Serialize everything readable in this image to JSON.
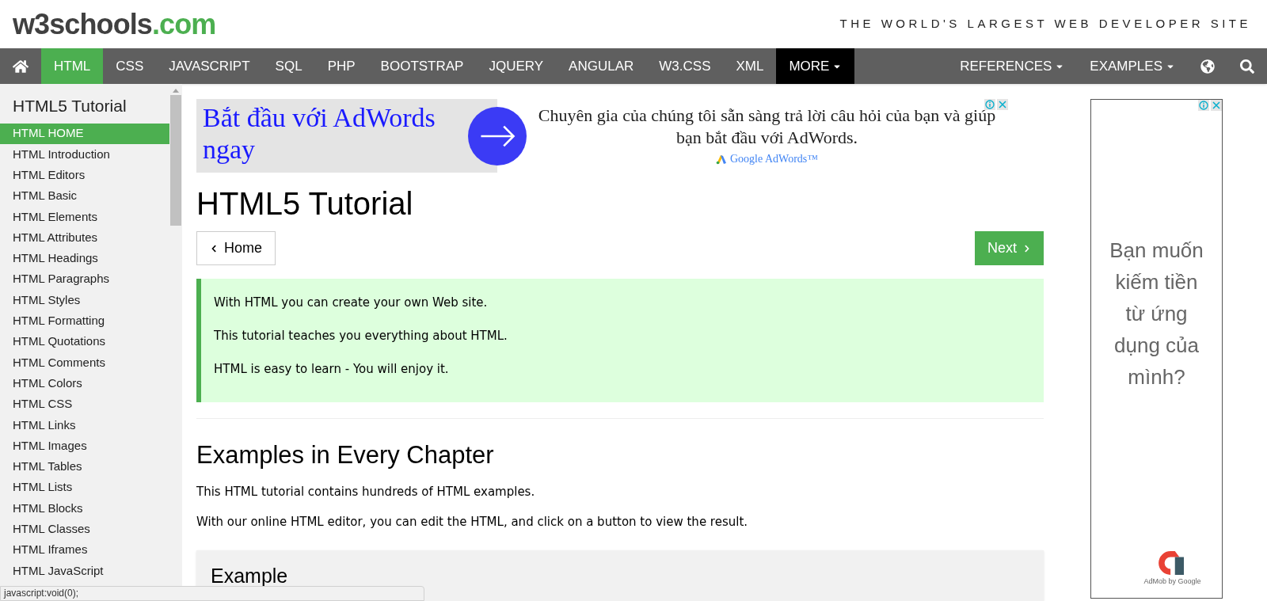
{
  "logo": {
    "name": "w3schools",
    "suffix": ".com"
  },
  "tagline": "THE WORLD'S LARGEST WEB DEVELOPER SITE",
  "nav_items": [
    {
      "label": "HTML",
      "kind": "link",
      "selected": true
    },
    {
      "label": "CSS",
      "kind": "link",
      "selected": false
    },
    {
      "label": "JAVASCRIPT",
      "kind": "link",
      "selected": false
    },
    {
      "label": "SQL",
      "kind": "link",
      "selected": false
    },
    {
      "label": "PHP",
      "kind": "link",
      "selected": false
    },
    {
      "label": "BOOTSTRAP",
      "kind": "link",
      "selected": false
    },
    {
      "label": "JQUERY",
      "kind": "link",
      "selected": false
    },
    {
      "label": "ANGULAR",
      "kind": "link",
      "selected": false
    },
    {
      "label": "W3.CSS",
      "kind": "link",
      "selected": false
    },
    {
      "label": "XML",
      "kind": "link",
      "selected": false
    },
    {
      "label": "MORE",
      "kind": "dropdown",
      "selected": false,
      "open": true
    }
  ],
  "nav_right": [
    {
      "label": "REFERENCES",
      "open": false
    },
    {
      "label": "EXAMPLES",
      "open": false
    }
  ],
  "sidebar": {
    "title": "HTML5 Tutorial",
    "items": [
      {
        "label": "HTML HOME",
        "selected": true
      },
      {
        "label": "HTML Introduction",
        "selected": false
      },
      {
        "label": "HTML Editors",
        "selected": false
      },
      {
        "label": "HTML Basic",
        "selected": false
      },
      {
        "label": "HTML Elements",
        "selected": false
      },
      {
        "label": "HTML Attributes",
        "selected": false
      },
      {
        "label": "HTML Headings",
        "selected": false
      },
      {
        "label": "HTML Paragraphs",
        "selected": false
      },
      {
        "label": "HTML Styles",
        "selected": false
      },
      {
        "label": "HTML Formatting",
        "selected": false
      },
      {
        "label": "HTML Quotations",
        "selected": false
      },
      {
        "label": "HTML Comments",
        "selected": false
      },
      {
        "label": "HTML Colors",
        "selected": false
      },
      {
        "label": "HTML CSS",
        "selected": false
      },
      {
        "label": "HTML Links",
        "selected": false
      },
      {
        "label": "HTML Images",
        "selected": false
      },
      {
        "label": "HTML Tables",
        "selected": false
      },
      {
        "label": "HTML Lists",
        "selected": false
      },
      {
        "label": "HTML Blocks",
        "selected": false
      },
      {
        "label": "HTML Classes",
        "selected": false
      },
      {
        "label": "HTML Iframes",
        "selected": false
      },
      {
        "label": "HTML JavaScript",
        "selected": false
      }
    ]
  },
  "banner_ad": {
    "headline": "Bắt đầu với AdWords ngay",
    "body": "Chuyên gia của chúng tôi sẵn sàng trả lời câu hỏi của bạn và giúp bạn bắt đầu với AdWords.",
    "brand": "Google AdWords™"
  },
  "main": {
    "title": "HTML5 Tutorial",
    "prev_button": "Home",
    "next_button": "Next",
    "note": [
      "With HTML you can create your own Web site.",
      "This tutorial teaches you everything about HTML.",
      "HTML is easy to learn - You will enjoy it."
    ],
    "section_title": "Examples in Every Chapter",
    "paragraphs": [
      "This HTML tutorial contains hundreds of HTML examples.",
      "With our online HTML editor, you can edit the HTML, and click on a button to view the result."
    ],
    "example_title": "Example"
  },
  "side_ad": {
    "text": "Bạn muốn kiếm tiền từ ứng dụng của mình?",
    "brand": "AdMob by Google"
  },
  "status_bar": "javascript:void(0);"
}
